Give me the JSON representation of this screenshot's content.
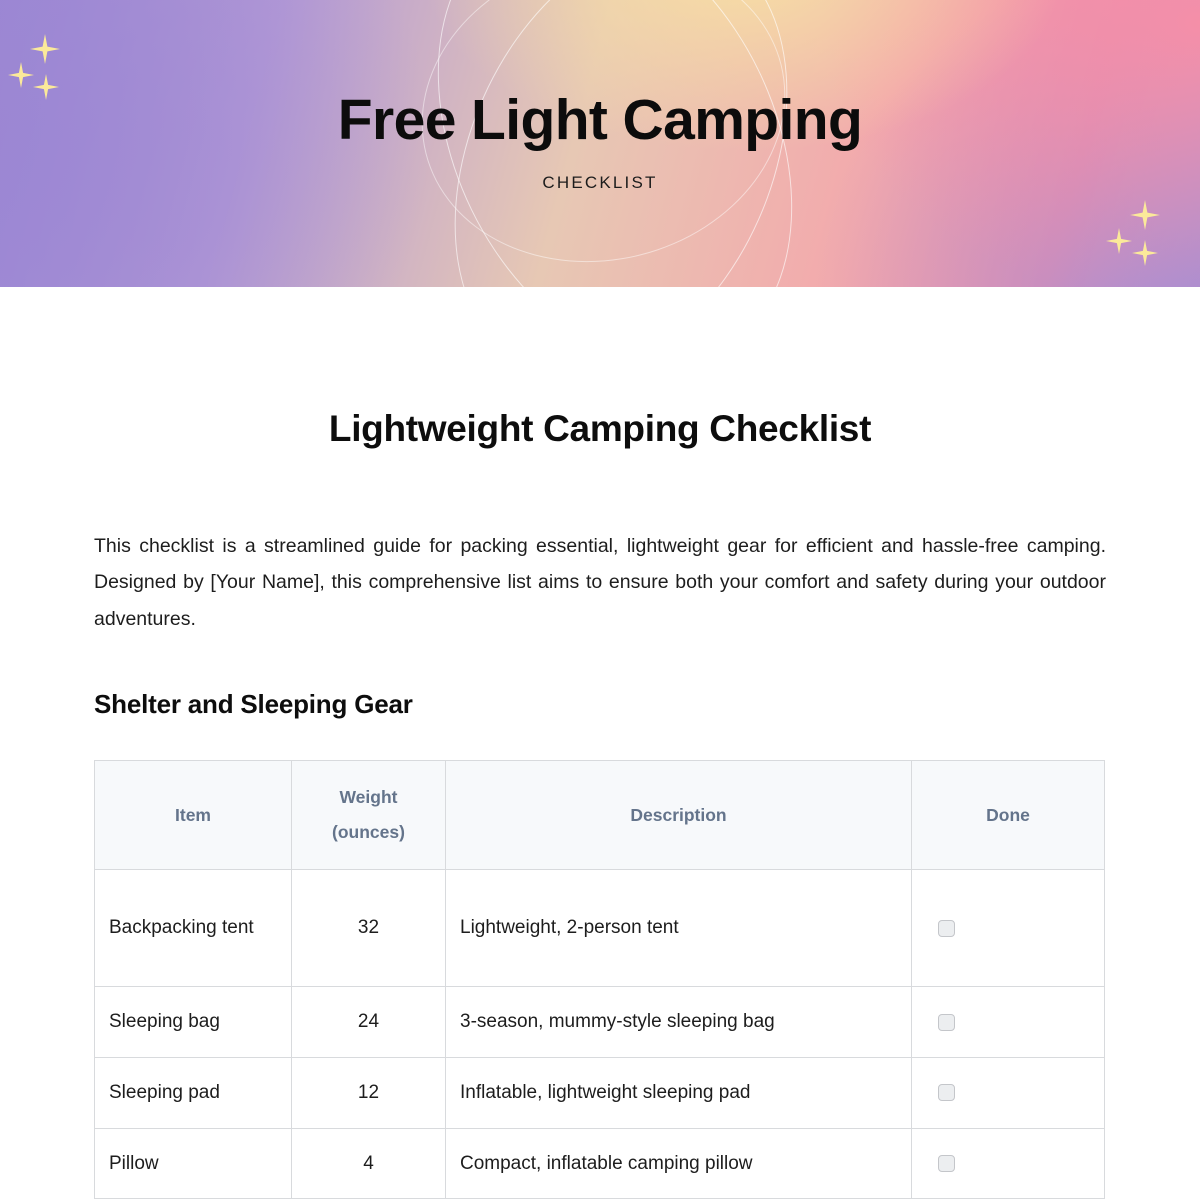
{
  "banner": {
    "title": "Free Light Camping",
    "subtitle": "CHECKLIST",
    "gradient_colors": [
      "#9c88d4",
      "#b49ad6",
      "#f7dfa4",
      "#f3a9ac",
      "#ef8fa9",
      "#b79ad2"
    ],
    "sparkle_color": "#fbe99a",
    "ring_color": "#ffffff",
    "sparkles_top_left": [
      "sparkle-icon",
      "sparkle-icon",
      "sparkle-icon"
    ],
    "sparkles_bottom_right": [
      "sparkle-icon",
      "sparkle-icon",
      "sparkle-icon"
    ]
  },
  "document": {
    "title": "Lightweight Camping Checklist",
    "intro": "This checklist is a streamlined guide for packing essential, lightweight gear for efficient and hassle-free camping. Designed by [Your Name], this comprehensive list aims to ensure both your comfort and safety during your outdoor adventures.",
    "sections": [
      {
        "heading": "Shelter and Sleeping Gear",
        "table": {
          "columns": [
            "Item",
            "Weight",
            "Description",
            "Done"
          ],
          "weight_unit_line": "(ounces)",
          "header_text_color": "#64748b",
          "header_bg_color": "#f7f9fb",
          "border_color": "#d8dadd",
          "rows": [
            {
              "item": "Backpacking tent",
              "weight": "32",
              "description": "Lightweight, 2-person tent",
              "done": false
            },
            {
              "item": "Sleeping bag",
              "weight": "24",
              "description": "3-season, mummy-style sleeping bag",
              "done": false
            },
            {
              "item": "Sleeping pad",
              "weight": "12",
              "description": "Inflatable, lightweight sleeping pad",
              "done": false
            },
            {
              "item": "Pillow",
              "weight": "4",
              "description": "Compact, inflatable camping pillow",
              "done": false
            }
          ]
        }
      }
    ]
  }
}
